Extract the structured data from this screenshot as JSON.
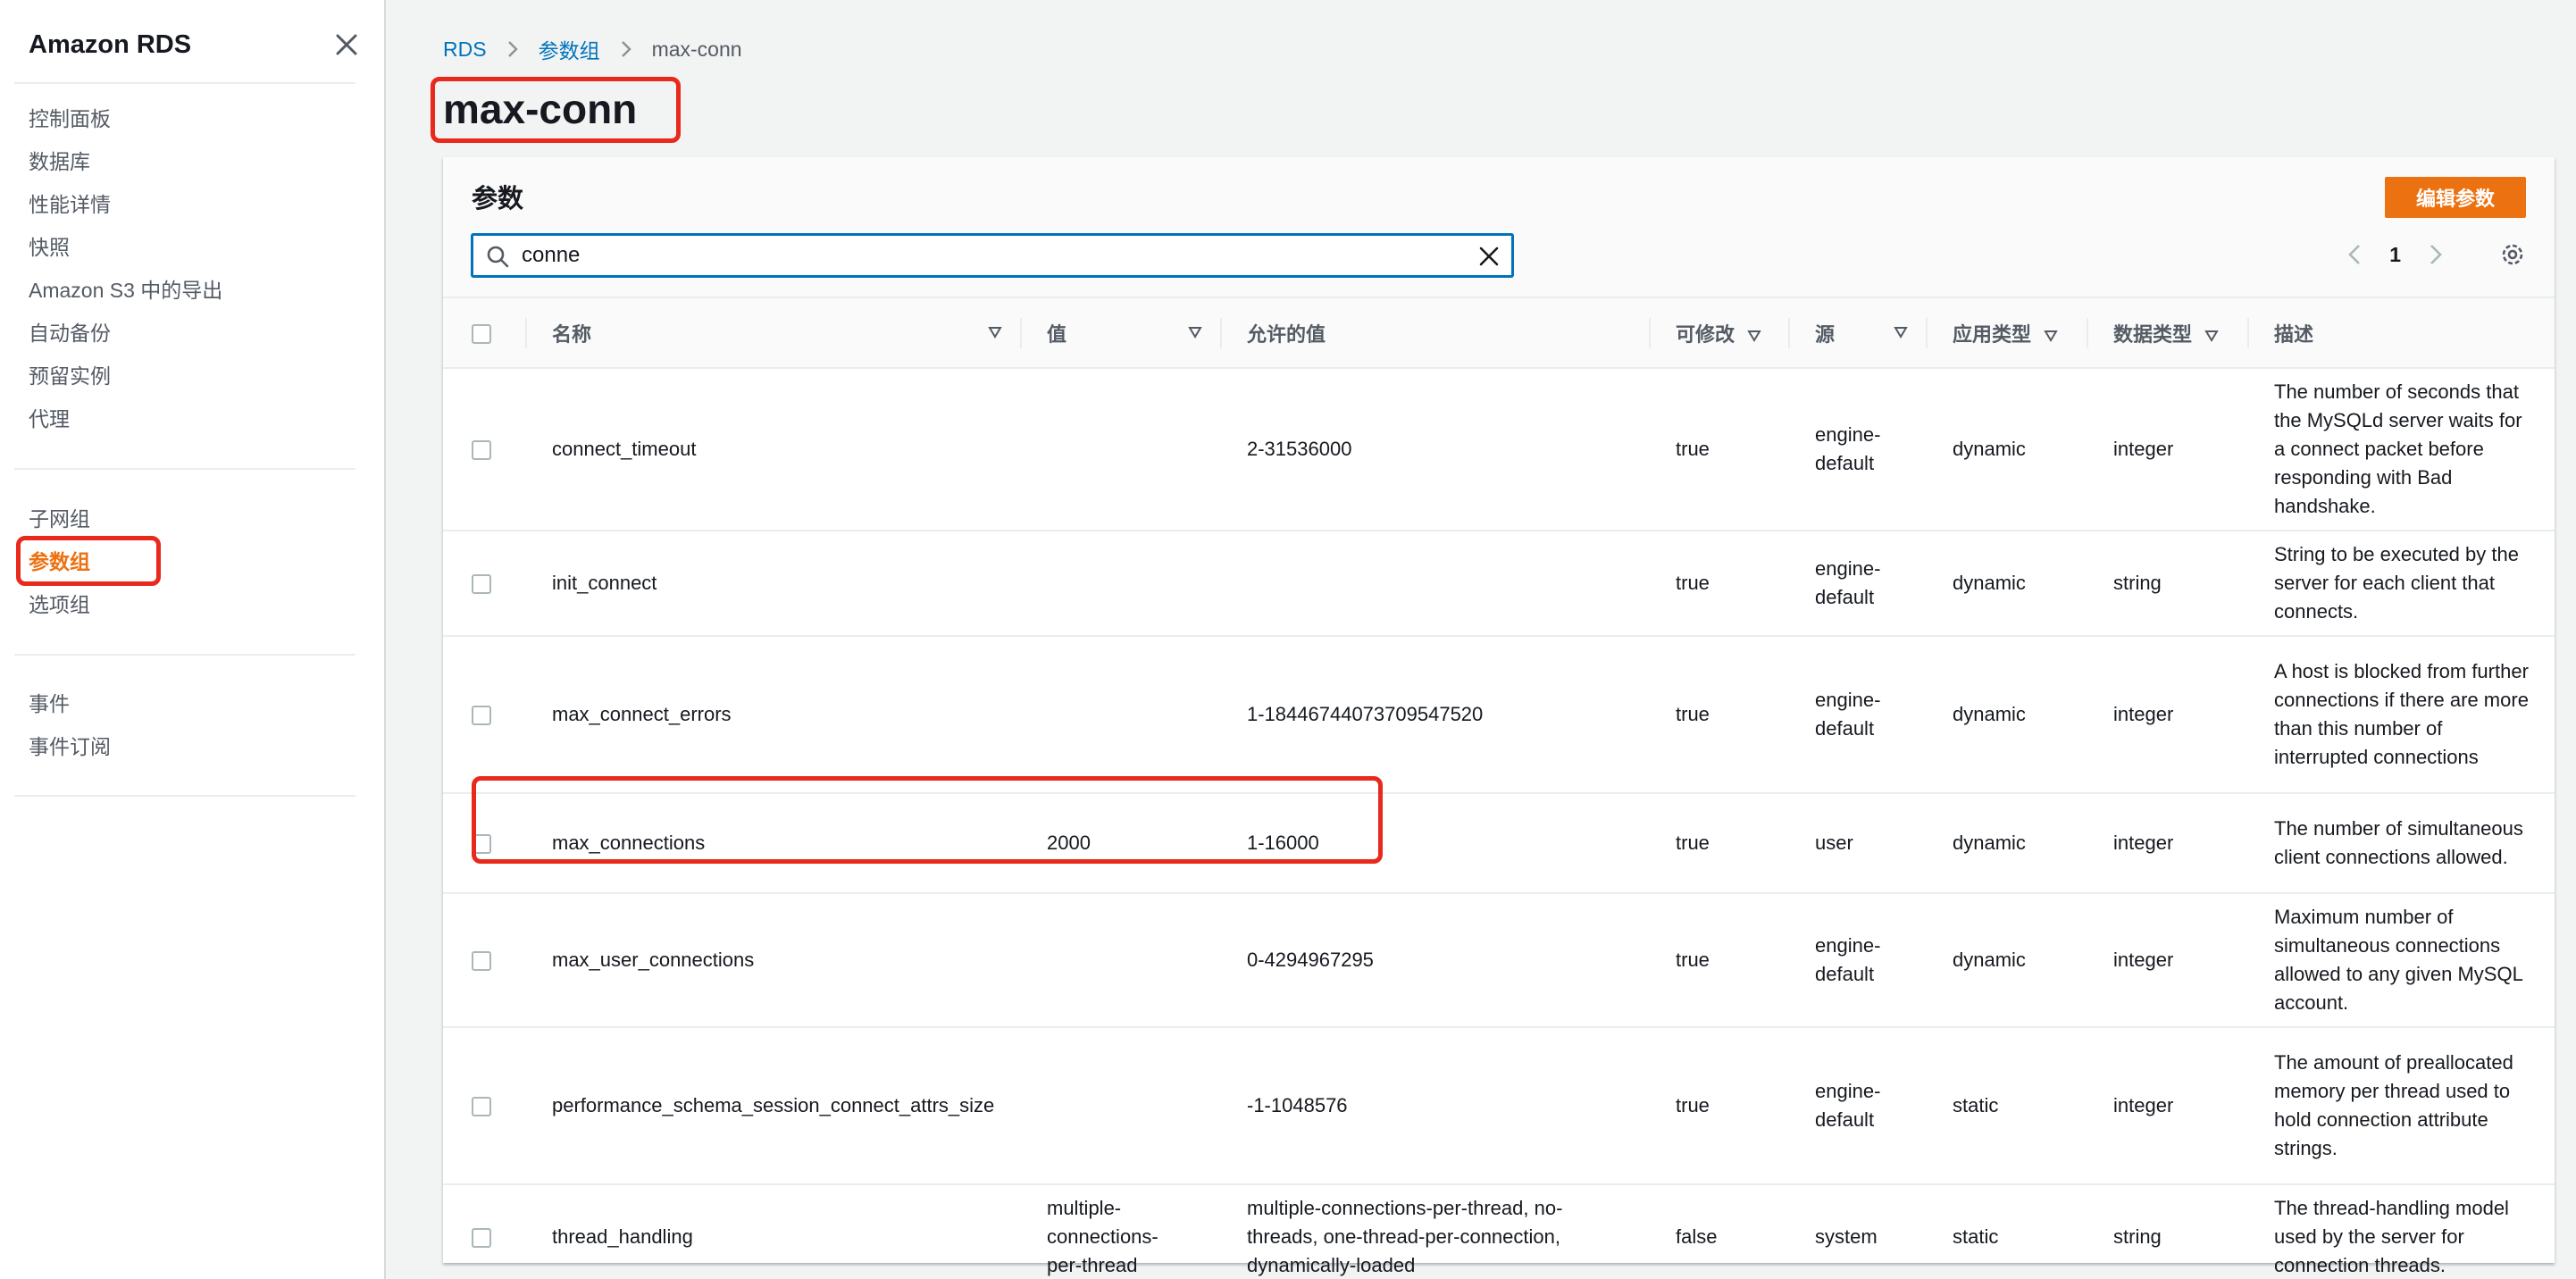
{
  "sidebar": {
    "title": "Amazon RDS",
    "group1": [
      "控制面板",
      "数据库",
      "性能详情",
      "快照",
      "Amazon S3 中的导出",
      "自动备份",
      "预留实例",
      "代理"
    ],
    "group2": [
      "子网组",
      "参数组",
      "选项组"
    ],
    "group3": [
      "事件",
      "事件订阅"
    ],
    "active_item": "参数组"
  },
  "breadcrumb": [
    "RDS",
    "参数组",
    "max-conn"
  ],
  "page_title": "max-conn",
  "panel": {
    "title": "参数",
    "edit_button": "编辑参数",
    "search_value": "conne",
    "page_number": "1"
  },
  "table": {
    "headers": [
      "名称",
      "值",
      "允许的值",
      "可修改",
      "源",
      "应用类型",
      "数据类型",
      "描述"
    ],
    "rows": [
      {
        "name": "connect_timeout",
        "value": "",
        "allowed": "2-31536000",
        "modifiable": "true",
        "source": "engine-\ndefault",
        "apply_type": "dynamic",
        "data_type": "integer",
        "description": "The number of seconds that the MySQLd server waits for a connect packet before responding with Bad handshake."
      },
      {
        "name": "init_connect",
        "value": "",
        "allowed": "",
        "modifiable": "true",
        "source": "engine-\ndefault",
        "apply_type": "dynamic",
        "data_type": "string",
        "description": "String to be executed by the server for each client that connects."
      },
      {
        "name": "max_connect_errors",
        "value": "",
        "allowed": "1-18446744073709547520",
        "modifiable": "true",
        "source": "engine-\ndefault",
        "apply_type": "dynamic",
        "data_type": "integer",
        "description": "A host is blocked from further connections if there are more than this number of interrupted connections"
      },
      {
        "name": "max_connections",
        "value": "2000",
        "allowed": "1-16000",
        "modifiable": "true",
        "source": "user",
        "apply_type": "dynamic",
        "data_type": "integer",
        "description": "The number of simultaneous client connections allowed."
      },
      {
        "name": "max_user_connections",
        "value": "",
        "allowed": "0-4294967295",
        "modifiable": "true",
        "source": "engine-\ndefault",
        "apply_type": "dynamic",
        "data_type": "integer",
        "description": "Maximum number of simultaneous connections allowed to any given MySQL account."
      },
      {
        "name": "performance_schema_session_connect_attrs_size",
        "value": "",
        "allowed": "-1-1048576",
        "modifiable": "true",
        "source": "engine-\ndefault",
        "apply_type": "static",
        "data_type": "integer",
        "description": "The amount of preallocated memory per thread used to hold connection attribute strings."
      },
      {
        "name": "thread_handling",
        "value": "multiple-\nconnections-\nper-thread",
        "allowed": "multiple-connections-per-thread, no-threads, one-thread-per-connection, dynamically-loaded",
        "modifiable": "false",
        "source": "system",
        "apply_type": "static",
        "data_type": "string",
        "description": "The thread-handling model used by the server for connection threads."
      }
    ]
  },
  "colors": {
    "accent": "#ec7211",
    "link": "#0073bb",
    "highlight": "#e8291c"
  }
}
